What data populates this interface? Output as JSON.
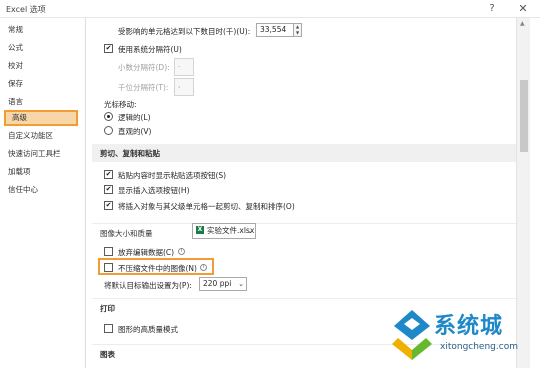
{
  "window": {
    "title": "Excel 选项",
    "help_glyph": "?",
    "close_glyph": "✕"
  },
  "sidebar": {
    "items": [
      {
        "label": "常规"
      },
      {
        "label": "公式"
      },
      {
        "label": "校对"
      },
      {
        "label": "保存"
      },
      {
        "label": "语言"
      },
      {
        "label": "高级"
      },
      {
        "label": "自定义功能区"
      },
      {
        "label": "快速访问工具栏"
      },
      {
        "label": "加载项"
      },
      {
        "label": "信任中心"
      }
    ],
    "active_index": 5
  },
  "content": {
    "unaffected_cells_label": "受影响的单元格达到以下数目时(千)(U):",
    "unaffected_cells_value": "33,554",
    "use_system_separators": {
      "label": "使用系统分隔符(U)",
      "checked": true
    },
    "decimal_separator": {
      "label": "小数分隔符(D):",
      "value": "."
    },
    "thousands_separator": {
      "label": "千位分隔符(T):",
      "value": ","
    },
    "cursor_movement_label": "光标移动:",
    "cursor_logical": {
      "label": "逻辑的(L)",
      "checked": true
    },
    "cursor_visual": {
      "label": "直观的(V)",
      "checked": false
    },
    "section_cut_copy_paste": "剪切、复制和粘贴",
    "show_paste_options": {
      "label": "粘贴内容时显示粘贴选项按钮(S)",
      "checked": true
    },
    "show_insert_options": {
      "label": "显示插入选项按钮(H)",
      "checked": true
    },
    "cut_copy_sort_objects": {
      "label": "将插入对象与其父级单元格一起剪切、复制和排序(O)",
      "checked": true
    },
    "section_image_size": "图像大小和质量",
    "image_file": "实验文件.xlsx",
    "discard_editing_data": {
      "label": "放弃编辑数据(C)",
      "checked": false
    },
    "do_not_compress": {
      "label": "不压缩文件中的图像(N)",
      "checked": false
    },
    "default_target_output_label": "将默认目标输出设置为(P):",
    "default_target_output_value": "220 ppi",
    "section_print": "打印",
    "high_quality_graphics": {
      "label": "图形的高质量模式",
      "checked": false
    },
    "section_chart": "图表"
  },
  "watermark": {
    "text": "系统城",
    "url": "xitongcheng.com"
  },
  "colors": {
    "highlight_orange": "#f39c33",
    "active_fill": "#f7d6a8",
    "section_bg": "#f0f0f0",
    "logo_blue": "#1e88c8"
  }
}
